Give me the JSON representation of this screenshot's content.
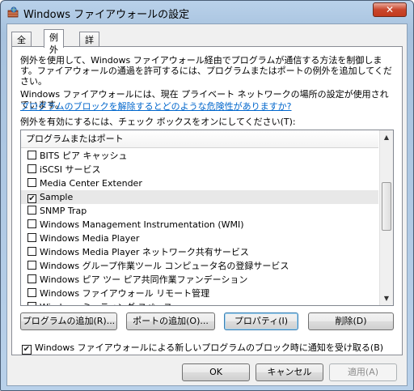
{
  "window": {
    "title": "Windows ファイアウォールの設定",
    "close_glyph": "✕"
  },
  "tabs": [
    {
      "label": "全般",
      "active": false
    },
    {
      "label": "例外",
      "active": true
    },
    {
      "label": "詳細設定",
      "active": false
    }
  ],
  "exceptions": {
    "description": "例外を使用して、Windows ファイアウォール経由でプログラムが通信する方法を制御します。ファイアウォールの通過を許可するには、プログラムまたはポートの例外を追加してください。",
    "network_notice": "Windows ファイアウォールには、現在 プライベート ネットワークの場所の設定が使用されています。",
    "risk_link": "プログラムのブロックを解除するとどのような危険性がありますか?",
    "list_prompt": "例外を有効にするには、チェック ボックスをオンにしてください(T):",
    "list_header": "プログラムまたはポート",
    "items": [
      {
        "label": "BITS ピア キャッシュ",
        "checked": false
      },
      {
        "label": "iSCSI サービス",
        "checked": false
      },
      {
        "label": "Media Center Extender",
        "checked": false
      },
      {
        "label": "Sample",
        "checked": true
      },
      {
        "label": "SNMP Trap",
        "checked": false
      },
      {
        "label": "Windows Management Instrumentation (WMI)",
        "checked": false
      },
      {
        "label": "Windows Media Player",
        "checked": false
      },
      {
        "label": "Windows Media Player ネットワーク共有サービス",
        "checked": false
      },
      {
        "label": "Windows グループ作業ツール コンピュータ名の登録サービス",
        "checked": false
      },
      {
        "label": "Windows ピア ツー ピア共同作業ファンデーション",
        "checked": false
      },
      {
        "label": "Windows ファイアウォール リモート管理",
        "checked": false
      },
      {
        "label": "Windows ミーティング スペース",
        "checked": false
      }
    ],
    "check_glyph": "✔",
    "buttons": {
      "add_program": "プログラムの追加(R)...",
      "add_port": "ポートの追加(O)...",
      "properties": "プロパティ(I)",
      "delete": "削除(D)"
    },
    "notify_label": "Windows ファイアウォールによる新しいプログラムのブロック時に通知を受け取る(B)",
    "notify_checked": true
  },
  "dialog_buttons": {
    "ok": "OK",
    "cancel": "キャンセル",
    "apply": "適用(A)"
  }
}
